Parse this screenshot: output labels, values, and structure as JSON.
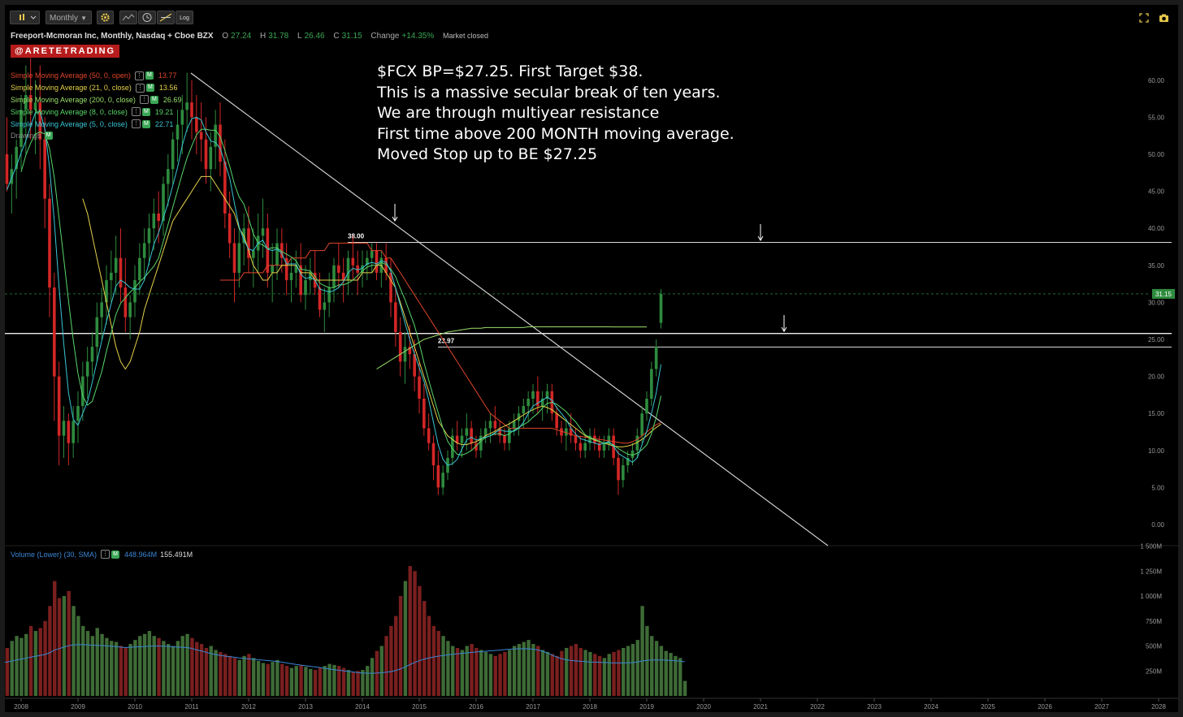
{
  "toolbar": {
    "chart_type_icon": "candles-icon",
    "timeframe": "Monthly",
    "settings_icon": "gear-icon",
    "indicators_icon": "indicators-icon",
    "clock_icon": "clock-icon",
    "drawing_icon": "crosshair-icon",
    "log_label": "Log",
    "fullscreen_icon": "fullscreen-icon",
    "snapshot_icon": "camera-icon"
  },
  "header": {
    "symbol_line": "Freeport-Mcmoran Inc, Monthly, Nasdaq + Cboe BZX",
    "open_label": "O",
    "open": "27.24",
    "high_label": "H",
    "high": "31.78",
    "low_label": "L",
    "low": "26.46",
    "close_label": "C",
    "close": "31.15",
    "change_label": "Change",
    "change": "+14.35%",
    "market_status": "Market closed"
  },
  "watermark": "@ARETETRADING",
  "legend": [
    {
      "label": "Simple Moving Average (50, 0, open)",
      "value": "13.77",
      "color": "#e0452b"
    },
    {
      "label": "Simple Moving Average (21, 0, close)",
      "value": "13.56",
      "color": "#e6d24a"
    },
    {
      "label": "Simple Moving Average (200, 0, close)",
      "value": "26.69",
      "color": "#9adf6b"
    },
    {
      "label": "Simple Moving Average (8, 0, close)",
      "value": "19.21",
      "color": "#58d66a"
    },
    {
      "label": "Simple Moving Average (5, 0, close)",
      "value": "22.71",
      "color": "#39c6d4"
    },
    {
      "label": "Drawings",
      "value": "",
      "color": "#888888"
    }
  ],
  "annotation": [
    "$FCX BP=$27.25. First Target $38.",
    "This is a massive secular break of ten years.",
    "We are through multiyear resistance",
    "First time above 200 MONTH moving average.",
    "Moved Stop up to BE $27.25"
  ],
  "levels": {
    "upper": "38.00",
    "lower": "23.97"
  },
  "price_tag": "31.15",
  "volume_legend": {
    "label": "Volume (Lower) (30, SMA)",
    "volume": "448.964M",
    "sma": "155.491M"
  },
  "price_axis": [
    "60.00",
    "55.00",
    "50.00",
    "45.00",
    "40.00",
    "35.00",
    "30.00",
    "25.00",
    "20.00",
    "15.00",
    "10.00",
    "5.00",
    "0.00"
  ],
  "volume_axis": [
    "1 500M",
    "1 250M",
    "1 000M",
    "750M",
    "500M",
    "250M"
  ],
  "time_axis": [
    "2008",
    "2009",
    "2010",
    "2011",
    "2012",
    "2013",
    "2014",
    "2015",
    "2016",
    "2017",
    "2018",
    "2019",
    "2020",
    "2021",
    "2022",
    "2023",
    "2024",
    "2025",
    "2026",
    "2027",
    "2028"
  ],
  "colors": {
    "up": "#2e8b3e",
    "down": "#d32626",
    "vol_up": "#3e6b36",
    "vol_down": "#7a1f1f",
    "vol_sma": "#3a86d4"
  },
  "chart_data": {
    "type": "candlestick",
    "interval": "monthly",
    "start": "2007-06",
    "ohlc_note": "open, high, low, close per month",
    "ohlc": [
      [
        38,
        41,
        35,
        40
      ],
      [
        40,
        45,
        37,
        43
      ],
      [
        43,
        48,
        40,
        47
      ],
      [
        47,
        52,
        44,
        50
      ],
      [
        50,
        55,
        45,
        46
      ],
      [
        46,
        50,
        42,
        48
      ],
      [
        48,
        52,
        44,
        51
      ],
      [
        51,
        58,
        48,
        56
      ],
      [
        56,
        62,
        50,
        58
      ],
      [
        58,
        63,
        52,
        56
      ],
      [
        56,
        60,
        50,
        57
      ],
      [
        57,
        62,
        48,
        52
      ],
      [
        52,
        55,
        40,
        44
      ],
      [
        44,
        46,
        28,
        32
      ],
      [
        32,
        34,
        14,
        20
      ],
      [
        20,
        22,
        8,
        12
      ],
      [
        12,
        16,
        9,
        14
      ],
      [
        14,
        15,
        8,
        11
      ],
      [
        11,
        16,
        9,
        14
      ],
      [
        14,
        18,
        11,
        16
      ],
      [
        16,
        22,
        14,
        20
      ],
      [
        20,
        24,
        17,
        22
      ],
      [
        22,
        26,
        20,
        24
      ],
      [
        24,
        30,
        22,
        28
      ],
      [
        28,
        32,
        25,
        30
      ],
      [
        30,
        35,
        27,
        33
      ],
      [
        33,
        37,
        30,
        34
      ],
      [
        34,
        39,
        31,
        36
      ],
      [
        36,
        40,
        30,
        32
      ],
      [
        32,
        36,
        26,
        28
      ],
      [
        28,
        31,
        25,
        30
      ],
      [
        30,
        35,
        28,
        33
      ],
      [
        33,
        38,
        31,
        36
      ],
      [
        36,
        40,
        33,
        38
      ],
      [
        38,
        42,
        35,
        40
      ],
      [
        40,
        44,
        37,
        42
      ],
      [
        42,
        45,
        38,
        41
      ],
      [
        41,
        47,
        39,
        46
      ],
      [
        46,
        50,
        43,
        48
      ],
      [
        48,
        53,
        46,
        52
      ],
      [
        52,
        56,
        49,
        54
      ],
      [
        54,
        58,
        50,
        56
      ],
      [
        56,
        61,
        53,
        57
      ],
      [
        57,
        60,
        52,
        55
      ],
      [
        55,
        58,
        50,
        53
      ],
      [
        53,
        57,
        49,
        52
      ],
      [
        52,
        55,
        46,
        48
      ],
      [
        48,
        53,
        45,
        51
      ],
      [
        51,
        56,
        48,
        54
      ],
      [
        54,
        57,
        47,
        49
      ],
      [
        49,
        52,
        40,
        42
      ],
      [
        42,
        45,
        36,
        38
      ],
      [
        38,
        40,
        30,
        34
      ],
      [
        34,
        40,
        32,
        38
      ],
      [
        38,
        42,
        35,
        40
      ],
      [
        40,
        43,
        34,
        36
      ],
      [
        36,
        40,
        32,
        37
      ],
      [
        37,
        42,
        34,
        39
      ],
      [
        39,
        44,
        36,
        40
      ],
      [
        40,
        42,
        32,
        34
      ],
      [
        34,
        38,
        30,
        35
      ],
      [
        35,
        40,
        33,
        38
      ],
      [
        38,
        40,
        34,
        36
      ],
      [
        36,
        38,
        31,
        33
      ],
      [
        33,
        36,
        30,
        34
      ],
      [
        34,
        37,
        32,
        35
      ],
      [
        35,
        38,
        30,
        31
      ],
      [
        31,
        35,
        29,
        33
      ],
      [
        33,
        36,
        31,
        34
      ],
      [
        34,
        37,
        31,
        32
      ],
      [
        32,
        34,
        28,
        29
      ],
      [
        29,
        32,
        26,
        30
      ],
      [
        30,
        34,
        28,
        32
      ],
      [
        32,
        36,
        30,
        35
      ],
      [
        35,
        38,
        32,
        34
      ],
      [
        34,
        36,
        30,
        33
      ],
      [
        33,
        37,
        31,
        36
      ],
      [
        36,
        39,
        33,
        35
      ],
      [
        35,
        37,
        31,
        34
      ],
      [
        34,
        37,
        32,
        35
      ],
      [
        35,
        37,
        33,
        36
      ],
      [
        36,
        38,
        34,
        37
      ],
      [
        37,
        38,
        33,
        34
      ],
      [
        34,
        37,
        32,
        36
      ],
      [
        36,
        38,
        33,
        34
      ],
      [
        34,
        36,
        28,
        30
      ],
      [
        30,
        32,
        24,
        26
      ],
      [
        26,
        28,
        20,
        22
      ],
      [
        22,
        26,
        19,
        24
      ],
      [
        24,
        27,
        21,
        23
      ],
      [
        23,
        25,
        18,
        20
      ],
      [
        20,
        22,
        15,
        17
      ],
      [
        17,
        19,
        12,
        13
      ],
      [
        13,
        15,
        10,
        11
      ],
      [
        11,
        12,
        6,
        8
      ],
      [
        8,
        10,
        4,
        5
      ],
      [
        5,
        8,
        4,
        7
      ],
      [
        7,
        10,
        6,
        9
      ],
      [
        9,
        13,
        8,
        12
      ],
      [
        12,
        14,
        10,
        11
      ],
      [
        11,
        13,
        9,
        12
      ],
      [
        12,
        15,
        10,
        13
      ],
      [
        13,
        14,
        10,
        11
      ],
      [
        11,
        12,
        9,
        10
      ],
      [
        10,
        13,
        9,
        12
      ],
      [
        12,
        14,
        11,
        13
      ],
      [
        13,
        15,
        11,
        14
      ],
      [
        14,
        16,
        12,
        13
      ],
      [
        13,
        14,
        11,
        12
      ],
      [
        12,
        13,
        10,
        11
      ],
      [
        11,
        14,
        10,
        13
      ],
      [
        13,
        15,
        12,
        14
      ],
      [
        14,
        16,
        12,
        15
      ],
      [
        15,
        17,
        13,
        16
      ],
      [
        16,
        18,
        14,
        17
      ],
      [
        17,
        19,
        15,
        18
      ],
      [
        18,
        20,
        15,
        16
      ],
      [
        16,
        18,
        14,
        17
      ],
      [
        17,
        19,
        15,
        18
      ],
      [
        18,
        19,
        14,
        15
      ],
      [
        15,
        16,
        12,
        13
      ],
      [
        13,
        14,
        11,
        12
      ],
      [
        12,
        14,
        10,
        13
      ],
      [
        13,
        15,
        11,
        12
      ],
      [
        12,
        13,
        10,
        11
      ],
      [
        11,
        12,
        9,
        10
      ],
      [
        10,
        12,
        9,
        11
      ],
      [
        11,
        13,
        10,
        12
      ],
      [
        12,
        13,
        10,
        11
      ],
      [
        11,
        12,
        9,
        10
      ],
      [
        10,
        12,
        9,
        11
      ],
      [
        11,
        13,
        10,
        12
      ],
      [
        12,
        13,
        8,
        9
      ],
      [
        9,
        10,
        4,
        6
      ],
      [
        6,
        9,
        5,
        8
      ],
      [
        8,
        10,
        7,
        9
      ],
      [
        9,
        11,
        8,
        10
      ],
      [
        10,
        13,
        9,
        12
      ],
      [
        12,
        16,
        11,
        15
      ],
      [
        15,
        18,
        14,
        17
      ],
      [
        17,
        22,
        16,
        21
      ],
      [
        21,
        25,
        20,
        24
      ],
      [
        27.24,
        31.78,
        26.46,
        31.15
      ]
    ],
    "sma_50_open": [
      null,
      null,
      null,
      null,
      null,
      null,
      null,
      null,
      null,
      null,
      null,
      null,
      null,
      null,
      null,
      null,
      null,
      null,
      null,
      null,
      null,
      null,
      null,
      null,
      null,
      null,
      null,
      null,
      null,
      null,
      null,
      null,
      null,
      null,
      null,
      null,
      null,
      null,
      null,
      null,
      null,
      null,
      null,
      null,
      null,
      null,
      null,
      null,
      null,
      33,
      33,
      33,
      33,
      33,
      34,
      34,
      34,
      34,
      34,
      35,
      35,
      35,
      35,
      35,
      36,
      36,
      36,
      36,
      37,
      37,
      37,
      37,
      38,
      38,
      38,
      38,
      38,
      38,
      38,
      38,
      38,
      37,
      37,
      37,
      36,
      36,
      35,
      34,
      33,
      32,
      31,
      30,
      29,
      28,
      27,
      26,
      25,
      24,
      23,
      22,
      21,
      20,
      19,
      18,
      17,
      16,
      15,
      14.5,
      14,
      13.5,
      13,
      13,
      13,
      13,
      13,
      13,
      13,
      13,
      13,
      13,
      12.8,
      12.6,
      12.4,
      12.2,
      12,
      11.9,
      11.8,
      11.7,
      11.6,
      11.5,
      11.4,
      11.3,
      11.2,
      11.1,
      11,
      11,
      11.2,
      11.5,
      12,
      12.5,
      13,
      13.5,
      13.77
    ],
    "sma_21_close": [
      null,
      null,
      null,
      null,
      null,
      null,
      null,
      null,
      null,
      null,
      null,
      null,
      null,
      null,
      null,
      null,
      null,
      null,
      null,
      null,
      44,
      42,
      39,
      36,
      33,
      30,
      27,
      24,
      22,
      21,
      22,
      24,
      26,
      29,
      31,
      33,
      35,
      37,
      39,
      41,
      42,
      43,
      44,
      45,
      46,
      47,
      47,
      47,
      46,
      45,
      44,
      43,
      42,
      40,
      39,
      37,
      35,
      34,
      33,
      33,
      34,
      34,
      35,
      35,
      35,
      35,
      34,
      34,
      34,
      33,
      33,
      33,
      33,
      33,
      33,
      33,
      33,
      33,
      33,
      34,
      34,
      34,
      35,
      35,
      34,
      33,
      32,
      30,
      28,
      26,
      24,
      22,
      20,
      18,
      16,
      14,
      13,
      12,
      11.5,
      11,
      10.8,
      10.8,
      11,
      11.2,
      11.5,
      12,
      12.3,
      12.6,
      13,
      13.3,
      13.6,
      14,
      14.4,
      14.8,
      15.2,
      15.5,
      15.8,
      16,
      15.8,
      15.5,
      15,
      14.5,
      14,
      13.5,
      13,
      12.5,
      12,
      11.7,
      11.4,
      11.2,
      11,
      10.8,
      10.6,
      10.5,
      10.5,
      10.6,
      10.8,
      11.1,
      11.5,
      12,
      12.6,
      13.1,
      13.56
    ],
    "sma_200_close": [
      null,
      null,
      null,
      null,
      null,
      null,
      null,
      null,
      null,
      null,
      null,
      null,
      null,
      null,
      null,
      null,
      null,
      null,
      null,
      null,
      null,
      null,
      null,
      null,
      null,
      null,
      null,
      null,
      null,
      null,
      null,
      null,
      null,
      null,
      null,
      null,
      null,
      null,
      null,
      null,
      null,
      null,
      null,
      null,
      null,
      null,
      null,
      null,
      null,
      null,
      null,
      null,
      null,
      null,
      null,
      null,
      null,
      null,
      null,
      null,
      null,
      null,
      null,
      null,
      null,
      null,
      null,
      null,
      null,
      null,
      null,
      null,
      null,
      null,
      null,
      null,
      null,
      null,
      null,
      null,
      null,
      null,
      21,
      21.4,
      21.8,
      22.2,
      22.6,
      23,
      23.4,
      23.8,
      24.2,
      24.6,
      25,
      25.2,
      25.4,
      25.6,
      25.8,
      26,
      26.1,
      26.2,
      26.3,
      26.4,
      26.5,
      26.5,
      26.5,
      26.6,
      26.6,
      26.6,
      26.6,
      26.6,
      26.6,
      26.6,
      26.6,
      26.6,
      26.7,
      26.7,
      26.7,
      26.7,
      26.7,
      26.7,
      26.7,
      26.7,
      26.7,
      26.7,
      26.7,
      26.7,
      26.7,
      26.7,
      26.7,
      26.7,
      26.7,
      26.7,
      26.69,
      26.69,
      26.69,
      26.69,
      26.69,
      26.69,
      26.69,
      26.69
    ],
    "sma_8_close": [],
    "sma_5_close": [],
    "volume_millions": [
      400,
      450,
      500,
      520,
      480,
      550,
      600,
      580,
      620,
      700,
      650,
      680,
      750,
      900,
      1150,
      980,
      1000,
      1050,
      900,
      800,
      700,
      650,
      600,
      680,
      620,
      580,
      550,
      540,
      500,
      480,
      520,
      560,
      600,
      620,
      650,
      600,
      580,
      550,
      520,
      500,
      550,
      600,
      620,
      580,
      540,
      520,
      480,
      500,
      460,
      440,
      420,
      400,
      380,
      360,
      400,
      420,
      380,
      350,
      330,
      320,
      340,
      360,
      320,
      300,
      280,
      300,
      310,
      290,
      270,
      260,
      280,
      300,
      320,
      310,
      300,
      280,
      260,
      240,
      250,
      260,
      300,
      380,
      450,
      500,
      600,
      700,
      800,
      1000,
      1150,
      1300,
      1250,
      1100,
      950,
      800,
      700,
      650,
      600,
      550,
      500,
      480,
      460,
      500,
      520,
      480,
      460,
      440,
      420,
      400,
      420,
      440,
      460,
      500,
      520,
      540,
      560,
      520,
      500,
      460,
      440,
      420,
      400,
      450,
      480,
      500,
      520,
      480,
      460,
      440,
      420,
      400,
      380,
      420,
      440,
      460,
      480,
      500,
      520,
      560,
      900,
      700,
      600,
      550,
      500,
      450,
      430,
      400,
      380,
      150
    ]
  }
}
